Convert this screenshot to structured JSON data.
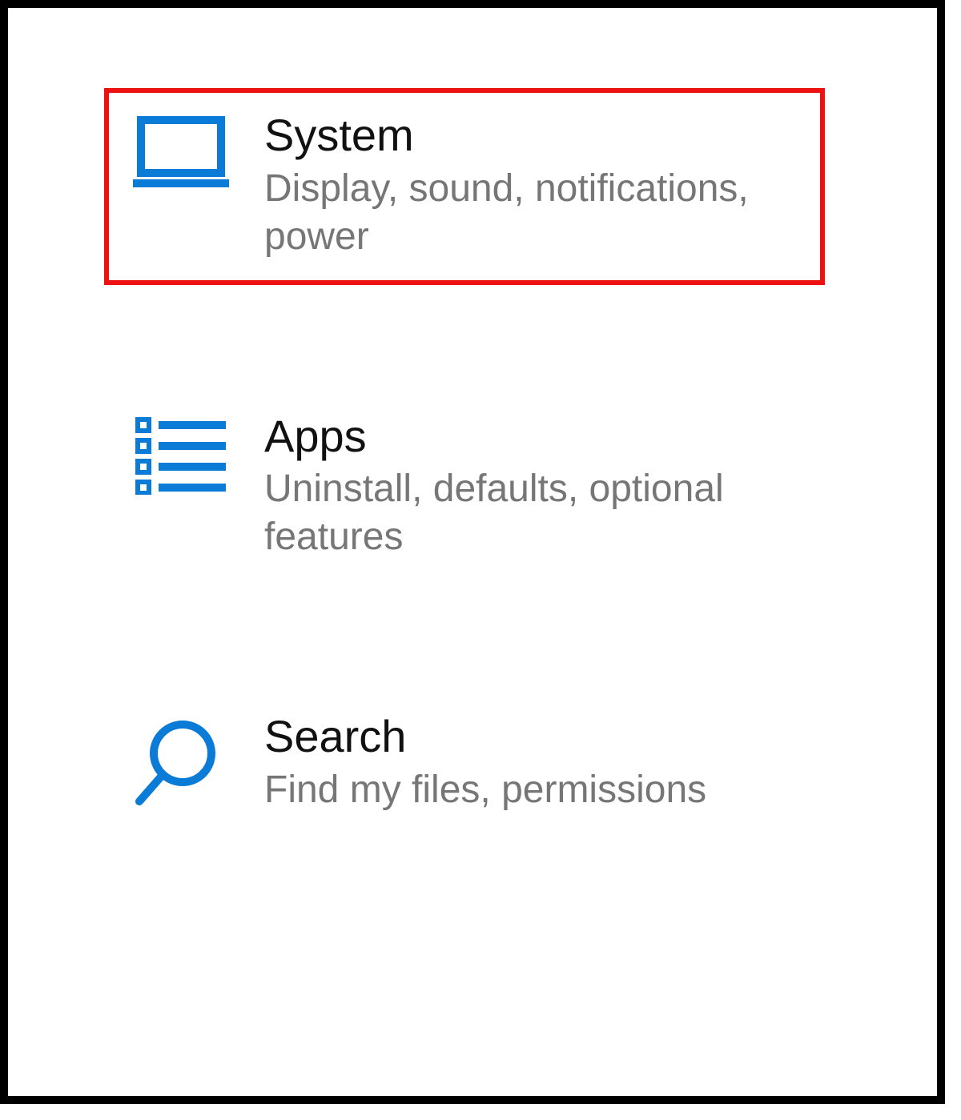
{
  "colors": {
    "iconBlue": "#0a7bd6",
    "descGray": "#767676",
    "highlightRed": "#e11"
  },
  "settings": {
    "items": [
      {
        "icon": "laptop",
        "title": "System",
        "desc": "Display, sound, notifications, power",
        "highlighted": true
      },
      {
        "icon": "apps",
        "title": "Apps",
        "desc": "Uninstall, defaults, optional features",
        "highlighted": false
      },
      {
        "icon": "search",
        "title": "Search",
        "desc": "Find my files, permissions",
        "highlighted": false
      }
    ]
  }
}
